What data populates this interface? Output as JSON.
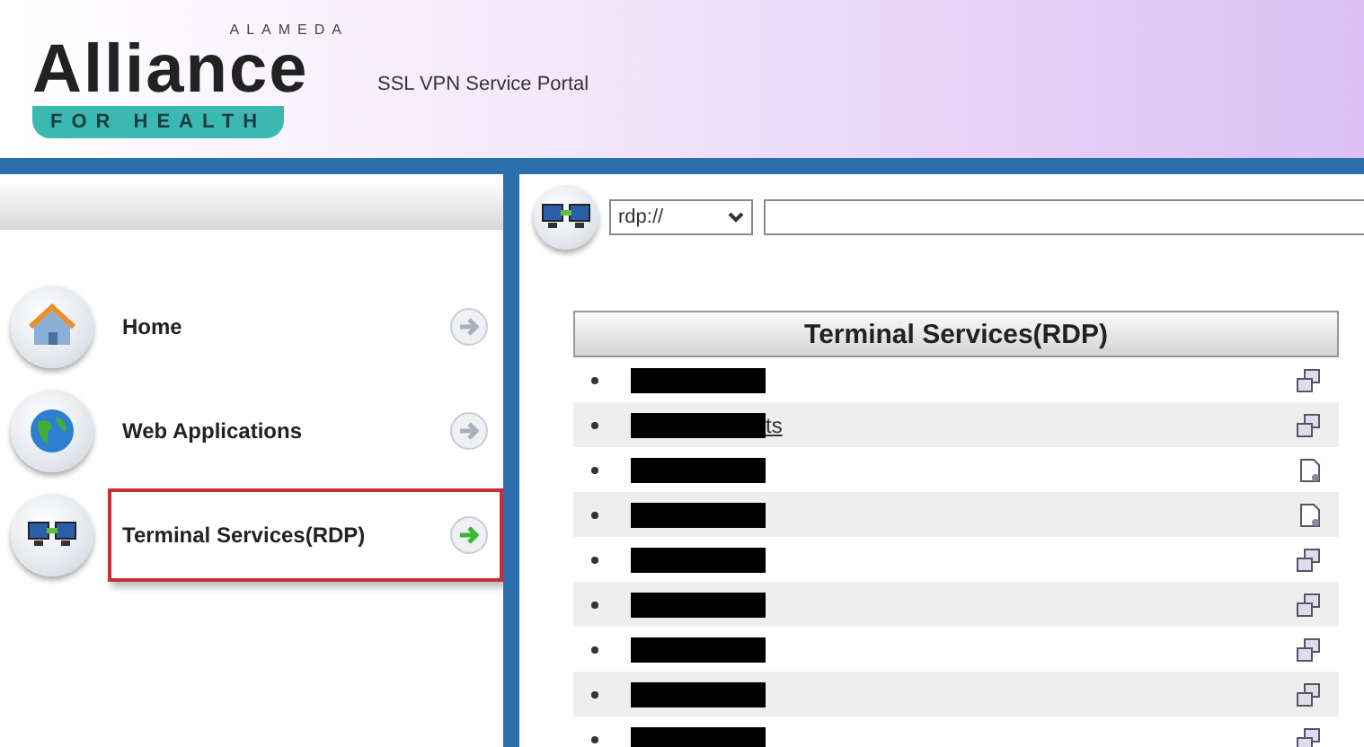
{
  "header": {
    "logo": {
      "top": "ALAMEDA",
      "main": "Alliance",
      "band": "FOR HEALTH"
    },
    "title": "SSL VPN Service Portal"
  },
  "sidebar": {
    "items": [
      {
        "label": "Home",
        "kind": "home",
        "selected": false
      },
      {
        "label": "Web Applications",
        "kind": "web",
        "selected": false
      },
      {
        "label": "Terminal Services(RDP)",
        "kind": "rdp",
        "selected": true
      }
    ]
  },
  "toolbar": {
    "protocol": "rdp://"
  },
  "table": {
    "title": "Terminal Services(RDP)",
    "rows": [
      {
        "kind": "desktop"
      },
      {
        "kind": "desktop",
        "suffix": "ts"
      },
      {
        "kind": "document"
      },
      {
        "kind": "document"
      },
      {
        "kind": "desktop"
      },
      {
        "kind": "desktop"
      },
      {
        "kind": "desktop"
      },
      {
        "kind": "desktop"
      },
      {
        "kind": "desktop"
      }
    ]
  }
}
